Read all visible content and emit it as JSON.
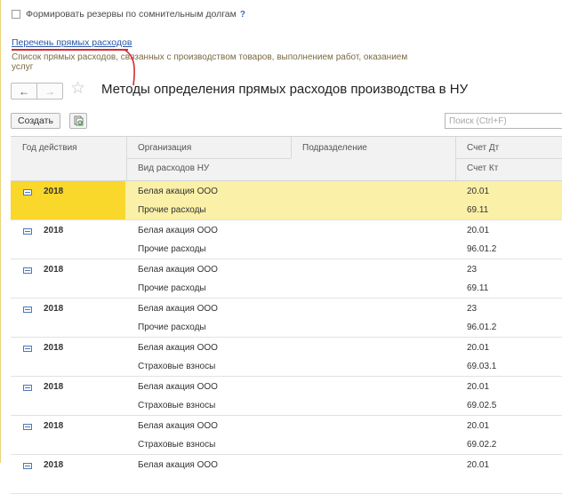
{
  "settings": {
    "reserve_label": "Формировать резервы по сомнительным долгам",
    "help_mark": "?",
    "link_text": "Перечень прямых расходов",
    "description": "Список прямых расходов, связанных с производством товаров, выполнением работ, оказанием услуг"
  },
  "window": {
    "back_label": "←",
    "forward_label": "→",
    "star_label": "☆",
    "title": "Методы определения прямых расходов производства в НУ"
  },
  "toolbar": {
    "create_label": "Создать",
    "search_placeholder": "Поиск (Ctrl+F)"
  },
  "table": {
    "headers": {
      "year": "Год действия",
      "org": "Организация",
      "expense_type": "Вид расходов НУ",
      "division": "Подразделение",
      "debit": "Счет Дт",
      "credit": "Счет Кт"
    },
    "rows": [
      {
        "year": "2018",
        "org": "Белая акация ООО",
        "expense_type": "Прочие расходы",
        "division": "",
        "debit": "20.01",
        "credit": "69.11",
        "selected": true
      },
      {
        "year": "2018",
        "org": "Белая акация ООО",
        "expense_type": "Прочие расходы",
        "division": "",
        "debit": "20.01",
        "credit": "96.01.2"
      },
      {
        "year": "2018",
        "org": "Белая акация ООО",
        "expense_type": "Прочие расходы",
        "division": "",
        "debit": "23",
        "credit": "69.11"
      },
      {
        "year": "2018",
        "org": "Белая акация ООО",
        "expense_type": "Прочие расходы",
        "division": "",
        "debit": "23",
        "credit": "96.01.2"
      },
      {
        "year": "2018",
        "org": "Белая акация ООО",
        "expense_type": "Страховые взносы",
        "division": "",
        "debit": "20.01",
        "credit": "69.03.1"
      },
      {
        "year": "2018",
        "org": "Белая акация ООО",
        "expense_type": "Страховые взносы",
        "division": "",
        "debit": "20.01",
        "credit": "69.02.5"
      },
      {
        "year": "2018",
        "org": "Белая акация ООО",
        "expense_type": "Страховые взносы",
        "division": "",
        "debit": "20.01",
        "credit": "69.02.2"
      },
      {
        "year": "2018",
        "org": "Белая акация ООО",
        "expense_type": "",
        "division": "",
        "debit": "20.01",
        "credit": ""
      }
    ]
  },
  "colors": {
    "selected_row": "#fbf0a8",
    "selected_year_cell": "#f9d72b",
    "link": "#2c58a8",
    "annotation_red": "#d9282f"
  }
}
